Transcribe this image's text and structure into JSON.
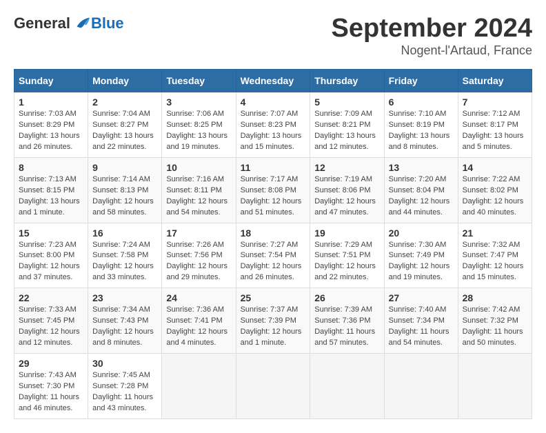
{
  "header": {
    "logo_general": "General",
    "logo_blue": "Blue",
    "month_year": "September 2024",
    "location": "Nogent-l'Artaud, France"
  },
  "calendar": {
    "days_of_week": [
      "Sunday",
      "Monday",
      "Tuesday",
      "Wednesday",
      "Thursday",
      "Friday",
      "Saturday"
    ],
    "weeks": [
      [
        {
          "day": "1",
          "sunrise": "7:03 AM",
          "sunset": "8:29 PM",
          "daylight": "13 hours and 26 minutes."
        },
        {
          "day": "2",
          "sunrise": "7:04 AM",
          "sunset": "8:27 PM",
          "daylight": "13 hours and 22 minutes."
        },
        {
          "day": "3",
          "sunrise": "7:06 AM",
          "sunset": "8:25 PM",
          "daylight": "13 hours and 19 minutes."
        },
        {
          "day": "4",
          "sunrise": "7:07 AM",
          "sunset": "8:23 PM",
          "daylight": "13 hours and 15 minutes."
        },
        {
          "day": "5",
          "sunrise": "7:09 AM",
          "sunset": "8:21 PM",
          "daylight": "13 hours and 12 minutes."
        },
        {
          "day": "6",
          "sunrise": "7:10 AM",
          "sunset": "8:19 PM",
          "daylight": "13 hours and 8 minutes."
        },
        {
          "day": "7",
          "sunrise": "7:12 AM",
          "sunset": "8:17 PM",
          "daylight": "13 hours and 5 minutes."
        }
      ],
      [
        {
          "day": "8",
          "sunrise": "7:13 AM",
          "sunset": "8:15 PM",
          "daylight": "13 hours and 1 minute."
        },
        {
          "day": "9",
          "sunrise": "7:14 AM",
          "sunset": "8:13 PM",
          "daylight": "12 hours and 58 minutes."
        },
        {
          "day": "10",
          "sunrise": "7:16 AM",
          "sunset": "8:11 PM",
          "daylight": "12 hours and 54 minutes."
        },
        {
          "day": "11",
          "sunrise": "7:17 AM",
          "sunset": "8:08 PM",
          "daylight": "12 hours and 51 minutes."
        },
        {
          "day": "12",
          "sunrise": "7:19 AM",
          "sunset": "8:06 PM",
          "daylight": "12 hours and 47 minutes."
        },
        {
          "day": "13",
          "sunrise": "7:20 AM",
          "sunset": "8:04 PM",
          "daylight": "12 hours and 44 minutes."
        },
        {
          "day": "14",
          "sunrise": "7:22 AM",
          "sunset": "8:02 PM",
          "daylight": "12 hours and 40 minutes."
        }
      ],
      [
        {
          "day": "15",
          "sunrise": "7:23 AM",
          "sunset": "8:00 PM",
          "daylight": "12 hours and 37 minutes."
        },
        {
          "day": "16",
          "sunrise": "7:24 AM",
          "sunset": "7:58 PM",
          "daylight": "12 hours and 33 minutes."
        },
        {
          "day": "17",
          "sunrise": "7:26 AM",
          "sunset": "7:56 PM",
          "daylight": "12 hours and 29 minutes."
        },
        {
          "day": "18",
          "sunrise": "7:27 AM",
          "sunset": "7:54 PM",
          "daylight": "12 hours and 26 minutes."
        },
        {
          "day": "19",
          "sunrise": "7:29 AM",
          "sunset": "7:51 PM",
          "daylight": "12 hours and 22 minutes."
        },
        {
          "day": "20",
          "sunrise": "7:30 AM",
          "sunset": "7:49 PM",
          "daylight": "12 hours and 19 minutes."
        },
        {
          "day": "21",
          "sunrise": "7:32 AM",
          "sunset": "7:47 PM",
          "daylight": "12 hours and 15 minutes."
        }
      ],
      [
        {
          "day": "22",
          "sunrise": "7:33 AM",
          "sunset": "7:45 PM",
          "daylight": "12 hours and 12 minutes."
        },
        {
          "day": "23",
          "sunrise": "7:34 AM",
          "sunset": "7:43 PM",
          "daylight": "12 hours and 8 minutes."
        },
        {
          "day": "24",
          "sunrise": "7:36 AM",
          "sunset": "7:41 PM",
          "daylight": "12 hours and 4 minutes."
        },
        {
          "day": "25",
          "sunrise": "7:37 AM",
          "sunset": "7:39 PM",
          "daylight": "12 hours and 1 minute."
        },
        {
          "day": "26",
          "sunrise": "7:39 AM",
          "sunset": "7:36 PM",
          "daylight": "11 hours and 57 minutes."
        },
        {
          "day": "27",
          "sunrise": "7:40 AM",
          "sunset": "7:34 PM",
          "daylight": "11 hours and 54 minutes."
        },
        {
          "day": "28",
          "sunrise": "7:42 AM",
          "sunset": "7:32 PM",
          "daylight": "11 hours and 50 minutes."
        }
      ],
      [
        {
          "day": "29",
          "sunrise": "7:43 AM",
          "sunset": "7:30 PM",
          "daylight": "11 hours and 46 minutes."
        },
        {
          "day": "30",
          "sunrise": "7:45 AM",
          "sunset": "7:28 PM",
          "daylight": "11 hours and 43 minutes."
        },
        null,
        null,
        null,
        null,
        null
      ]
    ]
  }
}
